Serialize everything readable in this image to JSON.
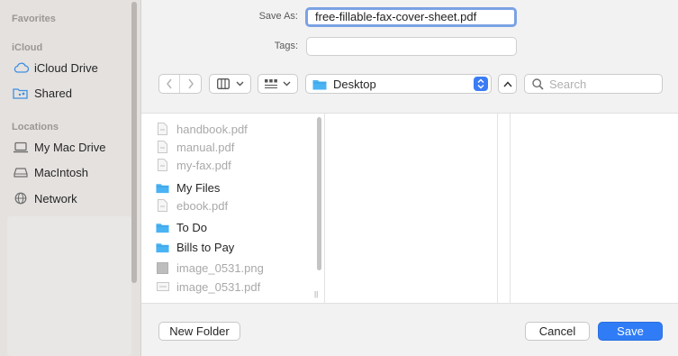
{
  "sidebar": {
    "sections": [
      {
        "heading": "Favorites",
        "items": []
      },
      {
        "heading": "iCloud",
        "items": [
          {
            "label": "iCloud Drive",
            "icon": "cloud-icon"
          },
          {
            "label": "Shared",
            "icon": "shared-folder-icon"
          }
        ]
      },
      {
        "heading": "Locations",
        "items": [
          {
            "label": "My Mac Drive",
            "icon": "laptop-icon"
          },
          {
            "label": "MacIntosh",
            "icon": "disk-icon"
          },
          {
            "label": "Network",
            "icon": "globe-icon"
          }
        ]
      }
    ]
  },
  "form": {
    "save_as_label": "Save As:",
    "save_as_value": "free-fillable-fax-cover-sheet.pdf",
    "tags_label": "Tags:",
    "tags_value": ""
  },
  "toolbar": {
    "location": "Desktop",
    "search_placeholder": "Search"
  },
  "files": [
    {
      "name": "handbook.pdf",
      "kind": "pdf"
    },
    {
      "name": "manual.pdf",
      "kind": "pdf"
    },
    {
      "name": "my-fax.pdf",
      "kind": "pdf"
    },
    {
      "name": "My Files",
      "kind": "folder"
    },
    {
      "name": "ebook.pdf",
      "kind": "pdf"
    },
    {
      "name": "To Do",
      "kind": "folder"
    },
    {
      "name": "Bills to Pay",
      "kind": "folder"
    },
    {
      "name": "image_0531.png",
      "kind": "image"
    },
    {
      "name": "image_0531.pdf",
      "kind": "pdf-landscape"
    }
  ],
  "buttons": {
    "new_folder": "New Folder",
    "cancel": "Cancel",
    "save": "Save"
  },
  "colors": {
    "accent": "#2f7cf6",
    "folder": "#4ab3f4"
  }
}
